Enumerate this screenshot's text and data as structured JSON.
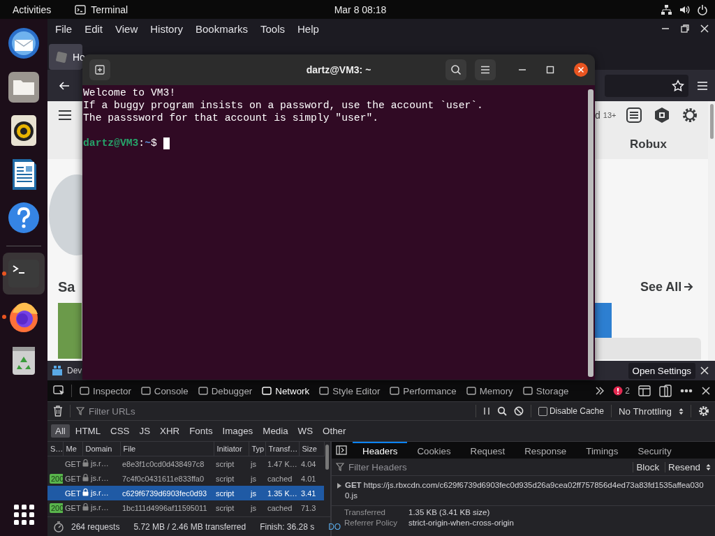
{
  "top_bar": {
    "activities": "Activities",
    "app_name": "Terminal",
    "clock": "Mar 8  08:18"
  },
  "dock": {
    "items": [
      {
        "kind": "mail",
        "running": false,
        "selected": false
      },
      {
        "kind": "files",
        "running": false,
        "selected": false
      },
      {
        "kind": "music",
        "running": false,
        "selected": false
      },
      {
        "kind": "writer",
        "running": false,
        "selected": false
      },
      {
        "kind": "help",
        "running": false,
        "selected": false
      },
      {
        "kind": "terminal",
        "running": true,
        "selected": true
      },
      {
        "kind": "firefox",
        "running": true,
        "selected": false
      },
      {
        "kind": "trash",
        "running": false,
        "selected": false
      }
    ]
  },
  "browser": {
    "menu": [
      "File",
      "Edit",
      "View",
      "History",
      "Bookmarks",
      "Tools",
      "Help"
    ],
    "tab": {
      "title": "Ho"
    },
    "page": {
      "partial_text": "d",
      "age_badge": "13+",
      "nav_link": "Robux",
      "section_title": "Sa",
      "see_all": "See All"
    },
    "devtools": {
      "tab_title": "Dev",
      "open_settings": "Open Settings",
      "tools": [
        {
          "label": "Inspector",
          "selected": false
        },
        {
          "label": "Console",
          "selected": false
        },
        {
          "label": "Debugger",
          "selected": false
        },
        {
          "label": "Network",
          "selected": true
        },
        {
          "label": "Style Editor",
          "selected": false
        },
        {
          "label": "Performance",
          "selected": false
        },
        {
          "label": "Memory",
          "selected": false
        },
        {
          "label": "Storage",
          "selected": false
        }
      ],
      "error_count": "2",
      "filter": {
        "placeholder": "Filter URLs"
      },
      "disable_cache": {
        "label": "Disable Cache",
        "checked": false
      },
      "throttling": "No Throttling",
      "type_filters": [
        {
          "label": "All",
          "selected": true
        },
        {
          "label": "HTML",
          "selected": false
        },
        {
          "label": "CSS",
          "selected": false
        },
        {
          "label": "JS",
          "selected": false
        },
        {
          "label": "XHR",
          "selected": false
        },
        {
          "label": "Fonts",
          "selected": false
        },
        {
          "label": "Images",
          "selected": false
        },
        {
          "label": "Media",
          "selected": false
        },
        {
          "label": "WS",
          "selected": false
        },
        {
          "label": "Other",
          "selected": false
        }
      ],
      "table": {
        "columns": [
          "S…",
          "Me",
          "Domain",
          "File",
          "Initiator",
          "Typ",
          "Transf…",
          "Size"
        ],
        "rows": [
          {
            "method": "GET",
            "domain": "js.r…",
            "file": "e8e3f1c0cd0d438497c8",
            "initiator": "script",
            "type": "js",
            "transferred": "1.47 K…",
            "size": "4.04",
            "selected": false
          },
          {
            "status": "200",
            "method": "GET",
            "domain": "js.r…",
            "file": "7c4f0c0431611e833ffa0",
            "initiator": "script",
            "type": "js",
            "transferred": "cached",
            "size": "4.01",
            "selected": false
          },
          {
            "method": "GET",
            "domain": "js.r…",
            "file": "c629f6739d6903fec0d93",
            "initiator": "script",
            "type": "js",
            "transferred": "1.35 K…",
            "size": "3.41",
            "selected": true
          },
          {
            "status": "200",
            "method": "GET",
            "domain": "js.r…",
            "file": "1bc111d4996af11595011",
            "initiator": "script",
            "type": "js",
            "transferred": "cached",
            "size": "71.3",
            "selected": false
          }
        ]
      },
      "status_bar": {
        "requests": "264 requests",
        "transferred": "5.72 MB / 2.46 MB transferred",
        "finish": "Finish: 36.28 s",
        "dom": "DO"
      },
      "details": {
        "tabs": [
          {
            "label": "Headers",
            "selected": true
          },
          {
            "label": "Cookies",
            "selected": false
          },
          {
            "label": "Request",
            "selected": false
          },
          {
            "label": "Response",
            "selected": false
          },
          {
            "label": "Timings",
            "selected": false
          },
          {
            "label": "Security",
            "selected": false
          }
        ],
        "filter_placeholder": "Filter Headers",
        "block": "Block",
        "resend": "Resend",
        "request": {
          "method": "GET",
          "url": "https://js.rbxcdn.com/c629f6739d6903fec0d935d26a9cea02ff757856d4ed73a83fd1535affea0300.js"
        },
        "fields": [
          {
            "name": "Transferred",
            "value": "1.35 KB (3.41 KB size)"
          },
          {
            "name": "Referrer Policy",
            "value": "strict-origin-when-cross-origin"
          }
        ]
      }
    }
  },
  "terminal": {
    "title": "dartz@VM3: ~",
    "lines": [
      "Welcome to VM3!",
      "If a buggy program insists on a password, use the account `user`.",
      "The passsword for that account is simply \"user\"."
    ],
    "prompt": {
      "user_host": "dartz@VM3",
      "separator": ":",
      "path": "~",
      "symbol": "$"
    }
  }
}
